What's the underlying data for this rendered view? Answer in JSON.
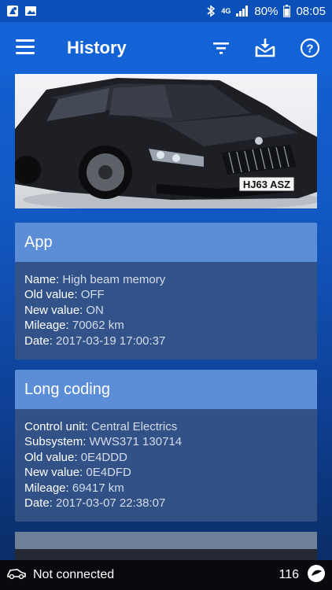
{
  "status_bar": {
    "battery_percent": "80%",
    "time": "08:05",
    "network": "4G",
    "icons": [
      "map-pin-notification-icon",
      "image-notification-icon",
      "bluetooth-icon",
      "signal-icon",
      "battery-icon"
    ]
  },
  "app_bar": {
    "title": "History",
    "icons": [
      "menu-icon",
      "filter-icon",
      "export-icon",
      "help-icon"
    ]
  },
  "car_image": {
    "plate": "HJ63 ASZ"
  },
  "entries": [
    {
      "title": "App",
      "rows": [
        {
          "key": "Name:",
          "value": "High beam memory"
        },
        {
          "key": "Old value:",
          "value": "OFF"
        },
        {
          "key": "New value:",
          "value": "ON"
        },
        {
          "key": "Mileage:",
          "value": "70062 km"
        },
        {
          "key": "Date:",
          "value": "2017-03-19 17:00:37"
        }
      ]
    },
    {
      "title": "Long coding",
      "rows": [
        {
          "key": "Control unit:",
          "value": "Central Electrics"
        },
        {
          "key": "Subsystem:",
          "value": "WWS371 130714"
        },
        {
          "key": "Old value:",
          "value": "0E4DDD"
        },
        {
          "key": "New value:",
          "value": "0E4DFD"
        },
        {
          "key": "Mileage:",
          "value": "69417 km"
        },
        {
          "key": "Date:",
          "value": "2017-03-07 22:38:07"
        }
      ]
    }
  ],
  "bottom_bar": {
    "connection_status": "Not connected",
    "count": "116"
  }
}
